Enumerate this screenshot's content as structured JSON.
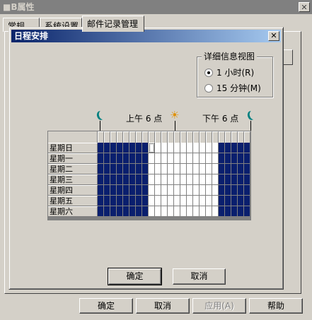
{
  "window": {
    "title": "■B属性",
    "close_glyph": "✕"
  },
  "tabs": [
    {
      "label": "常规",
      "active": false
    },
    {
      "label": "系统设置",
      "active": false
    },
    {
      "label": "邮件记录管理",
      "active": true
    }
  ],
  "footer": {
    "ok_label": "确定",
    "cancel_label": "取消",
    "apply_label": "应用(A)",
    "help_label": "帮助"
  },
  "dialog": {
    "title": "日程安排",
    "close_glyph": "✕",
    "detail_group": {
      "label": "详细信息视图",
      "options": [
        {
          "label": "1 小时(R)",
          "checked": true
        },
        {
          "label": "15 分钟(M)",
          "checked": false
        }
      ]
    },
    "timeline": {
      "am_label": "上午 6 点",
      "pm_label": "下午 6 点",
      "icons": [
        "moon-icon",
        "sun-icon",
        "moon-icon"
      ]
    },
    "schedule": {
      "hours_per_day": 24,
      "active_hours": [
        0,
        1,
        2,
        3,
        4,
        5,
        6,
        7,
        19,
        20,
        21,
        22,
        23
      ],
      "focused": {
        "day": 0,
        "hour": 8
      },
      "days": [
        "星期日",
        "星期一",
        "星期二",
        "星期三",
        "星期四",
        "星期五",
        "星期六"
      ]
    },
    "ok_label": "确定",
    "cancel_label": "取消"
  },
  "colors": {
    "active_cell": "#0a1f6e",
    "inactive_cell": "#ffffff",
    "title_gradient_start": "#0a246a",
    "title_gradient_end": "#a6caf0",
    "moon": "#008080",
    "sun": "#e09000"
  }
}
